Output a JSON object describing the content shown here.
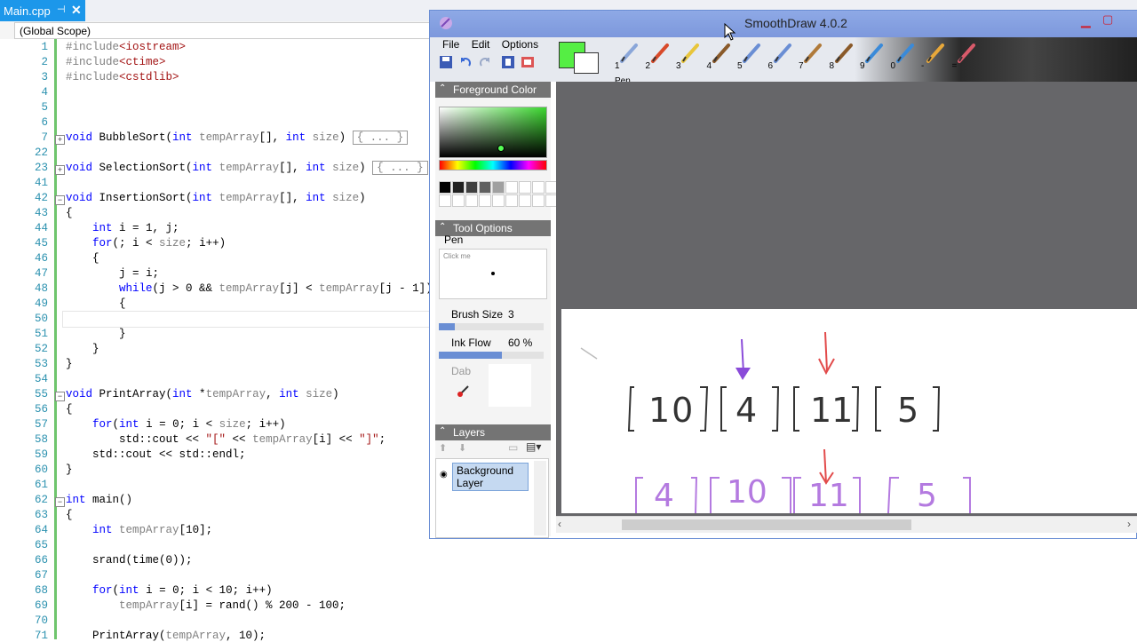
{
  "ide": {
    "tab": {
      "filename": "Main.cpp",
      "pin": "⊣",
      "close": "✕"
    },
    "scope": "(Global Scope)",
    "lines": [
      {
        "n": "1",
        "t": "#include<iostream>"
      },
      {
        "n": "2",
        "t": "#include<ctime>"
      },
      {
        "n": "3",
        "t": "#include<cstdlib>"
      },
      {
        "n": "4",
        "t": ""
      },
      {
        "n": "5",
        "t": ""
      },
      {
        "n": "6",
        "t": ""
      },
      {
        "n": "7",
        "t": "void BubbleSort(int tempArray[], int size) { ... }"
      },
      {
        "n": "22",
        "t": ""
      },
      {
        "n": "23",
        "t": "void SelectionSort(int tempArray[], int size) { ... }"
      },
      {
        "n": "41",
        "t": ""
      },
      {
        "n": "42",
        "t": "void InsertionSort(int tempArray[], int size)"
      },
      {
        "n": "43",
        "t": "{"
      },
      {
        "n": "44",
        "t": "    int i = 1, j;"
      },
      {
        "n": "45",
        "t": "    for(; i < size; i++)"
      },
      {
        "n": "46",
        "t": "    {"
      },
      {
        "n": "47",
        "t": "        j = i;"
      },
      {
        "n": "48",
        "t": "        while(j > 0 && tempArray[j] < tempArray[j - 1])"
      },
      {
        "n": "49",
        "t": "        {"
      },
      {
        "n": "50",
        "t": ""
      },
      {
        "n": "51",
        "t": "        }"
      },
      {
        "n": "52",
        "t": "    }"
      },
      {
        "n": "53",
        "t": "}"
      },
      {
        "n": "54",
        "t": ""
      },
      {
        "n": "55",
        "t": "void PrintArray(int *tempArray, int size)"
      },
      {
        "n": "56",
        "t": "{"
      },
      {
        "n": "57",
        "t": "    for(int i = 0; i < size; i++)"
      },
      {
        "n": "58",
        "t": "        std::cout << \"[\" << tempArray[i] << \"]\";"
      },
      {
        "n": "59",
        "t": "    std::cout << std::endl;"
      },
      {
        "n": "60",
        "t": "}"
      },
      {
        "n": "61",
        "t": ""
      },
      {
        "n": "62",
        "t": "int main()"
      },
      {
        "n": "63",
        "t": "{"
      },
      {
        "n": "64",
        "t": "    int tempArray[10];"
      },
      {
        "n": "65",
        "t": ""
      },
      {
        "n": "66",
        "t": "    srand(time(0));"
      },
      {
        "n": "67",
        "t": ""
      },
      {
        "n": "68",
        "t": "    for(int i = 0; i < 10; i++)"
      },
      {
        "n": "69",
        "t": "        tempArray[i] = rand() % 200 - 100;"
      },
      {
        "n": "70",
        "t": ""
      },
      {
        "n": "71",
        "t": "    PrintArray(tempArray, 10);"
      }
    ]
  },
  "smoothdraw": {
    "title": "SmoothDraw 4.0.2",
    "menu": [
      "File",
      "Edit",
      "Options"
    ],
    "colors": {
      "foreground": "#55ee44",
      "background": "#ffffff"
    },
    "tools": [
      {
        "num": "1",
        "icon": "pen-icon"
      },
      {
        "num": "2",
        "icon": "pencil-icon"
      },
      {
        "num": "3",
        "icon": "highlighter-icon"
      },
      {
        "num": "4",
        "icon": "brush-icon"
      },
      {
        "num": "5",
        "icon": "airbrush-icon"
      },
      {
        "num": "6",
        "icon": "airbrush-2-icon"
      },
      {
        "num": "7",
        "icon": "paintbrush-icon"
      },
      {
        "num": "8",
        "icon": "brush-2-icon"
      },
      {
        "num": "9",
        "icon": "star-brush-icon"
      },
      {
        "num": "0",
        "icon": "water-icon"
      },
      {
        "num": "-",
        "icon": "hand-icon"
      },
      {
        "num": "=",
        "icon": "eraser-icon"
      }
    ],
    "selected_tool": "Pen",
    "panels": {
      "foreground": "Foreground Color",
      "tool_options": "Tool Options",
      "layers": "Layers"
    },
    "tool_options": {
      "tool_name": "Pen",
      "click_me": "Click me",
      "brush_size_label": "Brush Size",
      "brush_size": "3",
      "ink_flow_label": "Ink Flow",
      "ink_flow": "60 %",
      "ink_flow_fraction": 0.6,
      "brush_size_fraction": 0.15,
      "dab_label": "Dab"
    },
    "layers": [
      {
        "name": "Background Layer"
      }
    ],
    "swatches": [
      "#000000",
      "#202020",
      "#404040",
      "#606060",
      "#a0a0a0",
      "#ffffff",
      "#ffffff",
      "#ffffff",
      "#ffffff"
    ],
    "drawing": {
      "row1": [
        "10",
        "4",
        "11",
        "5"
      ],
      "row2": [
        "4",
        "10",
        "11",
        "5"
      ]
    }
  }
}
